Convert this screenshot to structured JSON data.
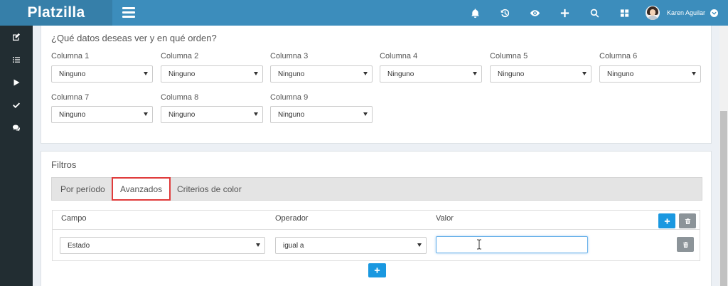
{
  "app": {
    "brand": "Platzilla"
  },
  "header": {
    "icons": [
      "bell-icon",
      "history-icon",
      "eye-icon",
      "plus-icon",
      "search-icon",
      "grid-icon"
    ],
    "user_name": "Karen Aguilar"
  },
  "sidebar": {
    "icons": [
      "edit-icon",
      "list-icon",
      "play-icon",
      "check-icon",
      "comments-icon"
    ]
  },
  "columns_section": {
    "title": "¿Qué datos deseas ver y en qué orden?",
    "columns": [
      {
        "label": "Columna 1",
        "value": "Ninguno"
      },
      {
        "label": "Columna 2",
        "value": "Ninguno"
      },
      {
        "label": "Columna 3",
        "value": "Ninguno"
      },
      {
        "label": "Columna 4",
        "value": "Ninguno"
      },
      {
        "label": "Columna 5",
        "value": "Ninguno"
      },
      {
        "label": "Columna 6",
        "value": "Ninguno"
      },
      {
        "label": "Columna 7",
        "value": "Ninguno"
      },
      {
        "label": "Columna 8",
        "value": "Ninguno"
      },
      {
        "label": "Columna 9",
        "value": "Ninguno"
      }
    ]
  },
  "filters": {
    "title": "Filtros",
    "tabs": [
      {
        "label": "Por período",
        "active": false
      },
      {
        "label": "Avanzados",
        "active": true
      },
      {
        "label": "Criterios de color",
        "active": false
      }
    ],
    "table": {
      "headers": {
        "field": "Campo",
        "operator": "Operador",
        "value": "Valor"
      },
      "row": {
        "field": "Estado",
        "operator": "igual a",
        "value": ""
      }
    }
  },
  "colors": {
    "topbar": "#3c8dbc",
    "brand_bg": "#367fa9",
    "sidebar": "#222d32",
    "primary_button": "#1a98e0",
    "danger_outline": "#e03b3b"
  }
}
